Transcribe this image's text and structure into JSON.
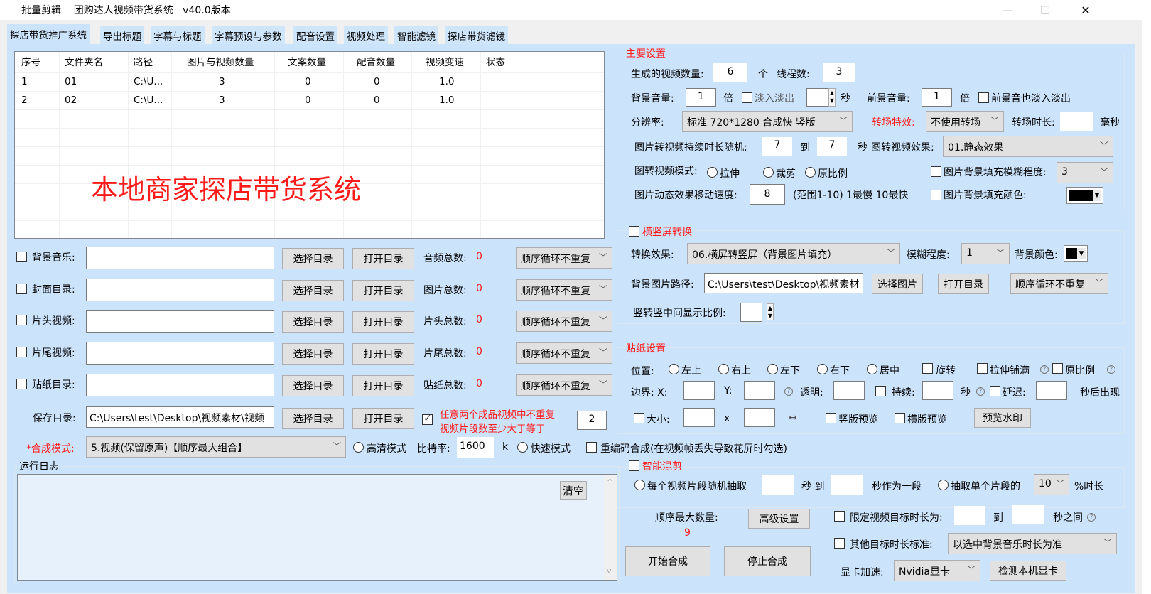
{
  "window": {
    "title": "批量剪辑    团购达人视频带货系统   v40.0版本",
    "minimize": "—",
    "maximize": "☐",
    "close": "✕"
  },
  "tabs": [
    "探店带货推广系统",
    "导出标题",
    "字幕与标题",
    "字幕预设与参数",
    "配音设置",
    "视频处理",
    "智能滤镜",
    "探店带货滤镜"
  ],
  "grid": {
    "columns": [
      "序号",
      "文件夹名",
      "路径",
      "图片与视频数量",
      "文案数量",
      "配音数量",
      "视频变速",
      "状态"
    ],
    "rows": [
      [
        "1",
        "01",
        "C:\\U...",
        "3",
        "0",
        "0",
        "1.0",
        ""
      ],
      [
        "2",
        "02",
        "C:\\U...",
        "3",
        "0",
        "0",
        "1.0",
        ""
      ]
    ],
    "overlay_title": "本地商家探店带货系统"
  },
  "dirs": [
    {
      "label": "背景音乐:",
      "value": "",
      "select": "选择目录",
      "open": "打开目录",
      "count_label": "音频总数:",
      "count": "0",
      "mode": "顺序循环不重复"
    },
    {
      "label": "封面目录:",
      "value": "",
      "select": "选择目录",
      "open": "打开目录",
      "count_label": "图片总数:",
      "count": "0",
      "mode": "顺序循环不重复"
    },
    {
      "label": "片头视频:",
      "value": "",
      "select": "选择目录",
      "open": "打开目录",
      "count_label": "片头总数:",
      "count": "0",
      "mode": "顺序循环不重复"
    },
    {
      "label": "片尾视频:",
      "value": "",
      "select": "选择目录",
      "open": "打开目录",
      "count_label": "片尾总数:",
      "count": "0",
      "mode": "顺序循环不重复"
    },
    {
      "label": "贴纸目录:",
      "value": "",
      "select": "选择目录",
      "open": "打开目录",
      "count_label": "贴纸总数:",
      "count": "0",
      "mode": "顺序循环不重复"
    }
  ],
  "save": {
    "label": "保存目录:",
    "value": "C:\\Users\\test\\Desktop\\视频素材\\视频",
    "select": "选择目录",
    "open": "打开目录",
    "no_repeat_line1": "任意两个成品视频中不重复",
    "no_repeat_line2": "视频片段数至少大于等于",
    "no_repeat_value": "2"
  },
  "compose": {
    "label": "*合成模式:",
    "mode": "5.视频(保留原声)【顺序最大组合】",
    "hd_mode": "高清模式",
    "bitrate_label": "比特率:",
    "bitrate": "1600",
    "bitrate_unit": "k",
    "fast_mode": "快速模式",
    "reencode": "重编码合成(在视频帧丢失导致花屏时勾选)"
  },
  "log": {
    "title": "运行日志",
    "clear": "清空",
    "scroll_up": "^",
    "scroll_down": "v"
  },
  "main_settings": {
    "title": "主要设置",
    "video_count_label": "生成的视频数量:",
    "video_count": "6",
    "unit_ge": "个",
    "threads_label": "线程数:",
    "threads": "3",
    "bg_volume_label": "背景音量:",
    "bg_volume": "1",
    "unit_bei": "倍",
    "fade": "淡入淡出",
    "fade_value": "",
    "unit_sec": "秒",
    "fg_volume_label": "前景音量:",
    "fg_volume": "1",
    "unit_bei2": "倍",
    "fg_fade": "前景音也淡入淡出",
    "resolution_label": "分辨率:",
    "resolution": "标准 720*1280 合成快 竖版",
    "transition_label": "转场特效:",
    "transition": "不使用转场",
    "transition_dur_label": "转场时长:",
    "transition_dur": "",
    "unit_ms": "毫秒",
    "img_dur_label": "图片转视频持续时长随机:",
    "img_dur_from": "7",
    "to": "到",
    "img_dur_to": "7",
    "unit_sec2": "秒",
    "img_effect_label": "图转视频效果:",
    "img_effect": "01.静态效果",
    "img_mode_label": "图转视频模式:",
    "img_mode_stretch": "拉伸",
    "img_mode_crop": "裁剪",
    "img_mode_orig": "原比例",
    "blur_fill_label": "图片背景填充模糊程度:",
    "blur_fill": "3",
    "speed_label": "图片动态效果移动速度:",
    "speed": "8",
    "speed_hint": "(范围1-10)  1最慢 10最快",
    "color_fill_label": "图片背景填充颜色:",
    "color_fill": "#000000"
  },
  "orientation": {
    "title": "横竖屏转换",
    "effect_label": "转换效果:",
    "effect": "06.横屏转竖屏（背景图片填充）",
    "blur_label": "模糊程度:",
    "blur": "1",
    "bg_color_label": "背景颜色:",
    "bg_color": "#000000",
    "bg_path_label": "背景图片路径:",
    "bg_path": "C:\\Users\\test\\Desktop\\视频素材",
    "select_img": "选择图片",
    "open_dir": "打开目录",
    "mode": "顺序循环不重复",
    "ratio_label": "竖转竖中间显示比例:",
    "ratio": ""
  },
  "sticker": {
    "title": "贴纸设置",
    "pos_label": "位置:",
    "positions": [
      "左上",
      "右上",
      "左下",
      "右下",
      "居中"
    ],
    "rotate": "旋转",
    "stretch": "拉伸铺满",
    "orig_ratio": "原比例",
    "border_x_label": "边界: X:",
    "border_y_label": "Y:",
    "alpha_label": "透明:",
    "duration_label": "持续:",
    "unit_sec": "秒",
    "delay_label": "延迟:",
    "delay_suffix": "秒后出现",
    "size_label": "大小:",
    "x_sep": "x",
    "swap": "↔",
    "vertical_preview": "竖版预览",
    "horizontal_preview": "横版预览",
    "preview_watermark": "预览水印"
  },
  "smart_mix": {
    "title": "智能混剪",
    "random_label": "每个视频片段随机抽取",
    "unit_sec_to": "秒 到",
    "as_segment": "秒作为一段",
    "single_label": "抽取单个片段的",
    "percent": "10",
    "percent_suffix": "%时长"
  },
  "bottom": {
    "max_seq_label": "顺序最大数量:",
    "max_seq": "9",
    "advanced": "高级设置",
    "start": "开始合成",
    "stop": "停止合成",
    "limit_label": "限定视频目标时长为:",
    "limit_to": "到",
    "limit_suffix": "秒之间",
    "other_label": "其他目标时长标准:",
    "other": "以选中背景音乐时长为准",
    "gpu_label": "显卡加速:",
    "gpu": "Nvidia显卡",
    "detect_gpu": "检测本机显卡"
  },
  "colors": {
    "accent_red": "#ff1a1a",
    "panel_bg": "#cce4fb"
  }
}
